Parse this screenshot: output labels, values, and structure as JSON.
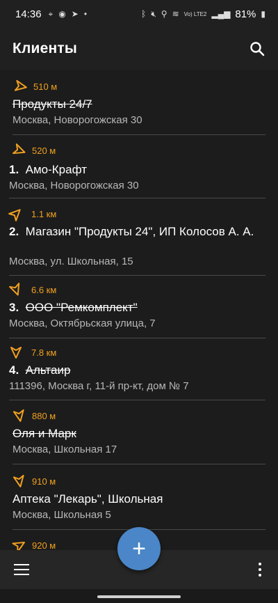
{
  "status": {
    "time": "14:36",
    "battery": "81%",
    "net": "Vo) LTE2"
  },
  "appbar": {
    "title": "Клиенты"
  },
  "items": [
    {
      "dist": "510 м",
      "num": "",
      "name": "Продукты 24/7",
      "struck": true,
      "addr": "Москва, Новорогожская 30"
    },
    {
      "dist": "520 м",
      "num": "1.",
      "name": "Амо-Крафт",
      "struck": false,
      "addr": "Москва, Новорогожская 30"
    },
    {
      "dist": "1.1 км",
      "num": "2.",
      "name": "Магазин \"Продукты 24\", ИП Колосов А. А.",
      "struck": false,
      "addr": "Москва, ул. Школьная, 15"
    },
    {
      "dist": "6.6 км",
      "num": "3.",
      "name": "ООО \"Ремкомплект\"",
      "struck": true,
      "addr": "Москва, Октябрьская улица, 7"
    },
    {
      "dist": "7.8 км",
      "num": "4.",
      "name": "Альтаир",
      "struck": true,
      "addr": "111396, Москва г, 11-й пр-кт, дом № 7"
    },
    {
      "dist": "880 м",
      "num": "",
      "name": "Оля и Марк",
      "struck": true,
      "addr": "Москва, Школьная 17"
    },
    {
      "dist": "910 м",
      "num": "",
      "name": "Аптека \"Лекарь\", Школьная",
      "struck": false,
      "addr": "Москва, Школьная 5"
    },
    {
      "dist": "920 м",
      "num": "",
      "name": "",
      "struck": false,
      "addr": ""
    }
  ],
  "fab": {
    "label": "+"
  },
  "colors": {
    "accent": "#f0a020",
    "fab": "#4a86c8",
    "background": "#1c1c1c"
  }
}
